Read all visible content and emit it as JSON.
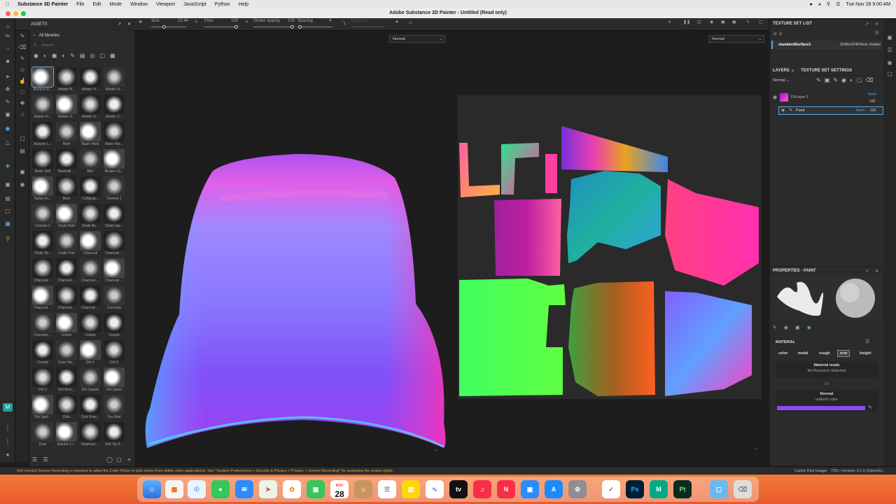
{
  "menubar": {
    "app": "Substance 3D Painter",
    "items": [
      "File",
      "Edit",
      "Mode",
      "Window",
      "Viewport",
      "JavaScript",
      "Python",
      "Help"
    ],
    "datetime": "Tue Nov 28  9:00 AM"
  },
  "window": {
    "title": "Adobe Substance 3D Painter - Untitled (Read only)"
  },
  "toolbar": {
    "size_label": "Size",
    "size_value": "10.44",
    "flow_label": "Flow",
    "flow_value": "100",
    "stroke_opacity_label": "Stroke opacity",
    "stroke_opacity_value": "100",
    "spacing_label": "Spacing",
    "spacing_value": "4",
    "distance_label": "Distance"
  },
  "assets": {
    "title": "ASSETS",
    "breadcrumb": "All libraries",
    "search_placeholder": "Search",
    "items": [
      "Archive In...",
      "Artistic B...",
      "Artistic H...",
      "Artistic H...",
      "Artistic Pr...",
      "Artistic S...",
      "Artistic S...",
      "Artistic S...",
      "Autumn L...",
      "Bark",
      "Basic Hard",
      "Basic Har...",
      "Basic Soft",
      "Basmati ...",
      "Blur",
      "Broken Gl...",
      "Bullet Im...",
      "Burn",
      "Calligrap...",
      "Cement 1",
      "Cement 2",
      "Chalk Bold",
      "Chalk Bu...",
      "Chalk Spr...",
      "Chalk Str...",
      "Chalk Thin",
      "Charcoal",
      "Charcoal ...",
      "Charcoal ...",
      "Charcoal ...",
      "Charcoal ...",
      "Charcoal ...",
      "Charcoal ...",
      "Charcoal ...",
      "Charcoal ...",
      "Concrete",
      "Concrete ...",
      "Cotton",
      "Cracks",
      "Cracks",
      "Crystal",
      "Dark Hat...",
      "Dirt 1",
      "Dirt 2",
      "Dirt 3",
      "Dirt Brus...",
      "Dirt Splash",
      "Dirt Spots",
      "Dirt Spot...",
      "Dots",
      "Dots Eras...",
      "Dry Mud",
      "Dust",
      "Electric Li...",
      "Elephant ...",
      "Felt Tip S..."
    ]
  },
  "viewport3d": {
    "mode": "Normal"
  },
  "viewport2d": {
    "mode": "Normal"
  },
  "texture_set_list": {
    "title": "TEXTURE SET LIST",
    "name": "standardSurface1",
    "resolution": "2048x2048",
    "shader": "Main shader"
  },
  "layers": {
    "tab_layers": "LAYERS",
    "tab_settings": "TEXTURE SET SETTINGS",
    "blend_mode": "Normal",
    "fill_layer": {
      "name": "Fill layer 1",
      "blend": "Norm",
      "opacity": "100"
    },
    "paint_layer": {
      "name": "Paint",
      "blend": "Norm",
      "opacity": "100"
    }
  },
  "properties": {
    "title": "PROPERTIES - PAINT",
    "material_label": "MATERIAL",
    "channels": [
      "color",
      "metal",
      "rough",
      "nrm",
      "height"
    ],
    "active_channel": "nrm",
    "material_mode_label": "Material mode",
    "material_mode_value": "No Resource Selected",
    "or_label": "Or",
    "normal_label": "Normal",
    "normal_sub": "uniform color",
    "normal_color": "#8a4bf0"
  },
  "status": {
    "message": "[Init checks] Screen Recording is required to allow the Color Picker to pick colors from within other applications. See \"System Preferences > Security & Privacy > Privacy > Screen Recording\" for assigning the proper rights.",
    "cache": "Cache Disk Usage:",
    "version": "73% | Version: 9.1.0 (OpenGL)"
  },
  "dock": {
    "calendar_day": "28",
    "calendar_month": "NOV"
  }
}
